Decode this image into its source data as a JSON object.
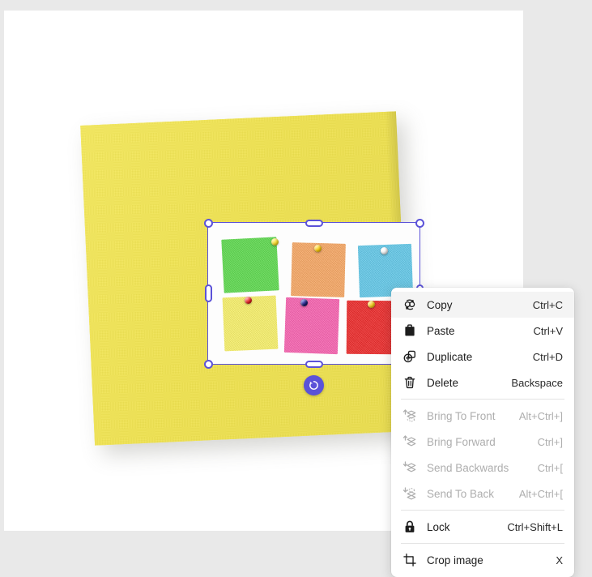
{
  "app": {
    "background_color": "#e9e9e9",
    "canvas_color": "#ffffff"
  },
  "canvas": {
    "artwork": {
      "name": "yellow-sticky-note-photo",
      "color": "#f0e453"
    },
    "selected_object": {
      "name": "sticky-notes-grid-image",
      "background_color": "#fdfdfd",
      "notes": [
        {
          "label": "green-note",
          "color": "#5ed94f",
          "pin_color": "#f5d623"
        },
        {
          "label": "orange-note",
          "color": "#f6a764",
          "pin_color": "#f7c600"
        },
        {
          "label": "blue-note",
          "color": "#63c8e8",
          "pin_color": "#f2f2f2"
        },
        {
          "label": "yellow-note",
          "color": "#f7f06a",
          "pin_color": "#e02020"
        },
        {
          "label": "pink-note",
          "color": "#f763b0",
          "pin_color": "#1a1a6e"
        },
        {
          "label": "red-note",
          "color": "#ec2b2b",
          "pin_color": "#f0c818"
        }
      ]
    },
    "selection": {
      "accent_color": "#5b52d8",
      "handle_fill": "#ffffff",
      "rotate_handle_name": "rotate-handle"
    }
  },
  "context_menu": {
    "highlighted_item": "Copy",
    "groups": [
      {
        "items": [
          {
            "icon": "copy-icon",
            "label": "Copy",
            "shortcut": "Ctrl+C",
            "disabled": false,
            "highlighted": true
          },
          {
            "icon": "paste-icon",
            "label": "Paste",
            "shortcut": "Ctrl+V",
            "disabled": false,
            "highlighted": false
          },
          {
            "icon": "duplicate-icon",
            "label": "Duplicate",
            "shortcut": "Ctrl+D",
            "disabled": false,
            "highlighted": false
          },
          {
            "icon": "delete-icon",
            "label": "Delete",
            "shortcut": "Backspace",
            "disabled": false,
            "highlighted": false
          }
        ]
      },
      {
        "items": [
          {
            "icon": "bring-to-front-icon",
            "label": "Bring To Front",
            "shortcut": "Alt+Ctrl+]",
            "disabled": true,
            "highlighted": false
          },
          {
            "icon": "bring-forward-icon",
            "label": "Bring Forward",
            "shortcut": "Ctrl+]",
            "disabled": true,
            "highlighted": false
          },
          {
            "icon": "send-backwards-icon",
            "label": "Send Backwards",
            "shortcut": "Ctrl+[",
            "disabled": true,
            "highlighted": false
          },
          {
            "icon": "send-to-back-icon",
            "label": "Send To Back",
            "shortcut": "Alt+Ctrl+[",
            "disabled": true,
            "highlighted": false
          }
        ]
      },
      {
        "items": [
          {
            "icon": "lock-icon",
            "label": "Lock",
            "shortcut": "Ctrl+Shift+L",
            "disabled": false,
            "highlighted": false
          }
        ]
      },
      {
        "items": [
          {
            "icon": "crop-icon",
            "label": "Crop image",
            "shortcut": "X",
            "disabled": false,
            "highlighted": false
          }
        ]
      }
    ]
  }
}
